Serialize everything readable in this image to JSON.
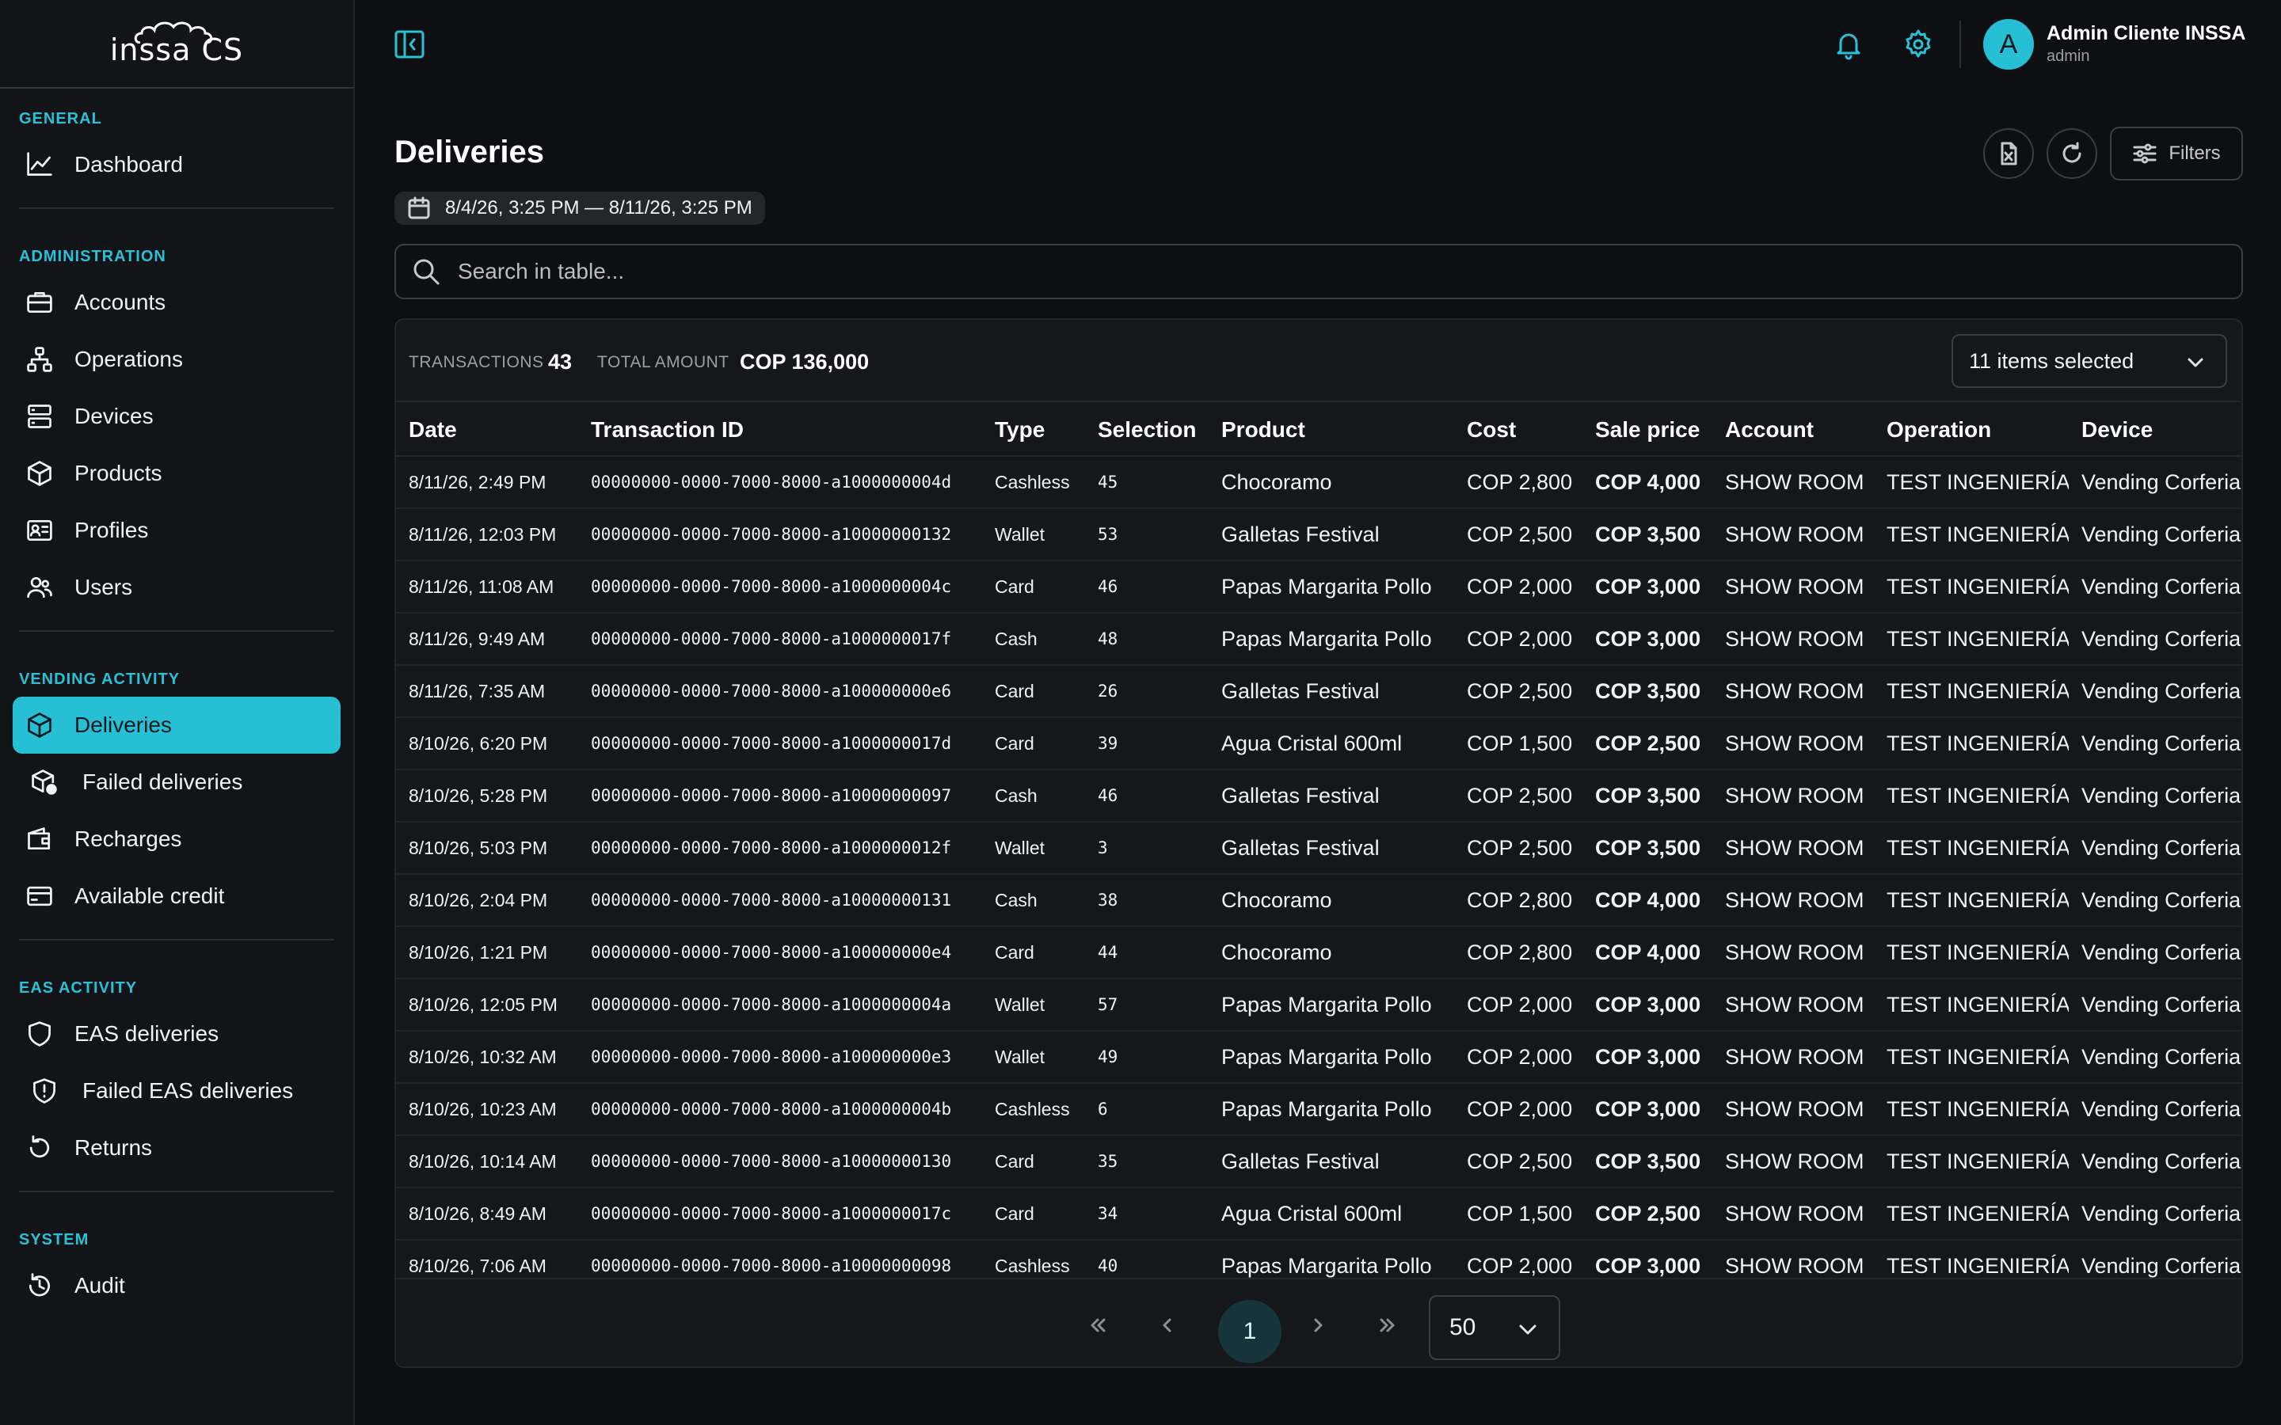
{
  "brand": {
    "logo_text": "inssa CS"
  },
  "sidebar": {
    "sections": [
      {
        "label": "GENERAL",
        "items": [
          {
            "label": "Dashboard",
            "icon": "chart-line-icon"
          }
        ]
      },
      {
        "label": "ADMINISTRATION",
        "items": [
          {
            "label": "Accounts",
            "icon": "briefcase-icon"
          },
          {
            "label": "Operations",
            "icon": "hierarchy-icon"
          },
          {
            "label": "Devices",
            "icon": "server-icon"
          },
          {
            "label": "Products",
            "icon": "box-icon"
          },
          {
            "label": "Profiles",
            "icon": "id-card-icon"
          },
          {
            "label": "Users",
            "icon": "users-icon"
          }
        ]
      },
      {
        "label": "VENDING ACTIVITY",
        "items": [
          {
            "label": "Deliveries",
            "icon": "box-icon",
            "active": true
          },
          {
            "label": "Failed deliveries",
            "icon": "box-alert-icon"
          },
          {
            "label": "Recharges",
            "icon": "wallet-icon"
          },
          {
            "label": "Available credit",
            "icon": "credit-card-icon"
          }
        ]
      },
      {
        "label": "EAS ACTIVITY",
        "items": [
          {
            "label": "EAS deliveries",
            "icon": "shield-icon"
          },
          {
            "label": "Failed EAS deliveries",
            "icon": "shield-alert-icon"
          },
          {
            "label": "Returns",
            "icon": "rotate-ccw-icon"
          }
        ]
      },
      {
        "label": "SYSTEM",
        "items": [
          {
            "label": "Audit",
            "icon": "history-icon"
          }
        ]
      }
    ]
  },
  "topbar": {
    "user": {
      "initial": "A",
      "name": "Admin Cliente INSSA",
      "role": "admin"
    }
  },
  "page": {
    "title": "Deliveries",
    "date_range": "8/4/26, 3:25 PM — 8/11/26, 3:25 PM",
    "filters_label": "Filters",
    "search_placeholder": "Search in table..."
  },
  "summary": {
    "transactions_label": "TRANSACTIONS",
    "transactions_value": "43",
    "total_label": "TOTAL AMOUNT",
    "total_value": "COP 136,000",
    "columns_selected": "11 items selected"
  },
  "table": {
    "columns": [
      "Date",
      "Transaction ID",
      "Type",
      "Selection",
      "Product",
      "Cost",
      "Sale price",
      "Account",
      "Operation",
      "Device"
    ],
    "rows": [
      [
        "8/11/26, 2:49 PM",
        "00000000-0000-7000-8000-a1000000004d",
        "Cashless",
        "45",
        "Chocoramo",
        "COP 2,800",
        "COP 4,000",
        "SHOW ROOM",
        "TEST INGENIERÍA",
        "Vending Corferias"
      ],
      [
        "8/11/26, 12:03 PM",
        "00000000-0000-7000-8000-a10000000132",
        "Wallet",
        "53",
        "Galletas Festival",
        "COP 2,500",
        "COP 3,500",
        "SHOW ROOM",
        "TEST INGENIERÍA",
        "Vending Corferias"
      ],
      [
        "8/11/26, 11:08 AM",
        "00000000-0000-7000-8000-a1000000004c",
        "Card",
        "46",
        "Papas Margarita Pollo",
        "COP 2,000",
        "COP 3,000",
        "SHOW ROOM",
        "TEST INGENIERÍA",
        "Vending Corferias"
      ],
      [
        "8/11/26, 9:49 AM",
        "00000000-0000-7000-8000-a1000000017f",
        "Cash",
        "48",
        "Papas Margarita Pollo",
        "COP 2,000",
        "COP 3,000",
        "SHOW ROOM",
        "TEST INGENIERÍA",
        "Vending Corferias"
      ],
      [
        "8/11/26, 7:35 AM",
        "00000000-0000-7000-8000-a100000000e6",
        "Card",
        "26",
        "Galletas Festival",
        "COP 2,500",
        "COP 3,500",
        "SHOW ROOM",
        "TEST INGENIERÍA",
        "Vending Corferias"
      ],
      [
        "8/10/26, 6:20 PM",
        "00000000-0000-7000-8000-a1000000017d",
        "Card",
        "39",
        "Agua Cristal 600ml",
        "COP 1,500",
        "COP 2,500",
        "SHOW ROOM",
        "TEST INGENIERÍA",
        "Vending Corferias"
      ],
      [
        "8/10/26, 5:28 PM",
        "00000000-0000-7000-8000-a10000000097",
        "Cash",
        "46",
        "Galletas Festival",
        "COP 2,500",
        "COP 3,500",
        "SHOW ROOM",
        "TEST INGENIERÍA",
        "Vending Corferias"
      ],
      [
        "8/10/26, 5:03 PM",
        "00000000-0000-7000-8000-a1000000012f",
        "Wallet",
        "3",
        "Galletas Festival",
        "COP 2,500",
        "COP 3,500",
        "SHOW ROOM",
        "TEST INGENIERÍA",
        "Vending Corferias"
      ],
      [
        "8/10/26, 2:04 PM",
        "00000000-0000-7000-8000-a10000000131",
        "Cash",
        "38",
        "Chocoramo",
        "COP 2,800",
        "COP 4,000",
        "SHOW ROOM",
        "TEST INGENIERÍA",
        "Vending Corferias"
      ],
      [
        "8/10/26, 1:21 PM",
        "00000000-0000-7000-8000-a100000000e4",
        "Card",
        "44",
        "Chocoramo",
        "COP 2,800",
        "COP 4,000",
        "SHOW ROOM",
        "TEST INGENIERÍA",
        "Vending Corferias"
      ],
      [
        "8/10/26, 12:05 PM",
        "00000000-0000-7000-8000-a1000000004a",
        "Wallet",
        "57",
        "Papas Margarita Pollo",
        "COP 2,000",
        "COP 3,000",
        "SHOW ROOM",
        "TEST INGENIERÍA",
        "Vending Corferias"
      ],
      [
        "8/10/26, 10:32 AM",
        "00000000-0000-7000-8000-a100000000e3",
        "Wallet",
        "49",
        "Papas Margarita Pollo",
        "COP 2,000",
        "COP 3,000",
        "SHOW ROOM",
        "TEST INGENIERÍA",
        "Vending Corferias"
      ],
      [
        "8/10/26, 10:23 AM",
        "00000000-0000-7000-8000-a1000000004b",
        "Cashless",
        "6",
        "Papas Margarita Pollo",
        "COP 2,000",
        "COP 3,000",
        "SHOW ROOM",
        "TEST INGENIERÍA",
        "Vending Corferias"
      ],
      [
        "8/10/26, 10:14 AM",
        "00000000-0000-7000-8000-a10000000130",
        "Card",
        "35",
        "Galletas Festival",
        "COP 2,500",
        "COP 3,500",
        "SHOW ROOM",
        "TEST INGENIERÍA",
        "Vending Corferias"
      ],
      [
        "8/10/26, 8:49 AM",
        "00000000-0000-7000-8000-a1000000017c",
        "Card",
        "34",
        "Agua Cristal 600ml",
        "COP 1,500",
        "COP 2,500",
        "SHOW ROOM",
        "TEST INGENIERÍA",
        "Vending Corferias"
      ],
      [
        "8/10/26, 7:06 AM",
        "00000000-0000-7000-8000-a10000000098",
        "Cashless",
        "40",
        "Papas Margarita Pollo",
        "COP 2,000",
        "COP 3,000",
        "SHOW ROOM",
        "TEST INGENIERÍA",
        "Vending Corferias"
      ]
    ]
  },
  "pagination": {
    "current_page": "1",
    "page_size": "50"
  },
  "colors": {
    "accent": "#27bfd3",
    "background": "#0d0f12",
    "sidebar": "#121417"
  }
}
